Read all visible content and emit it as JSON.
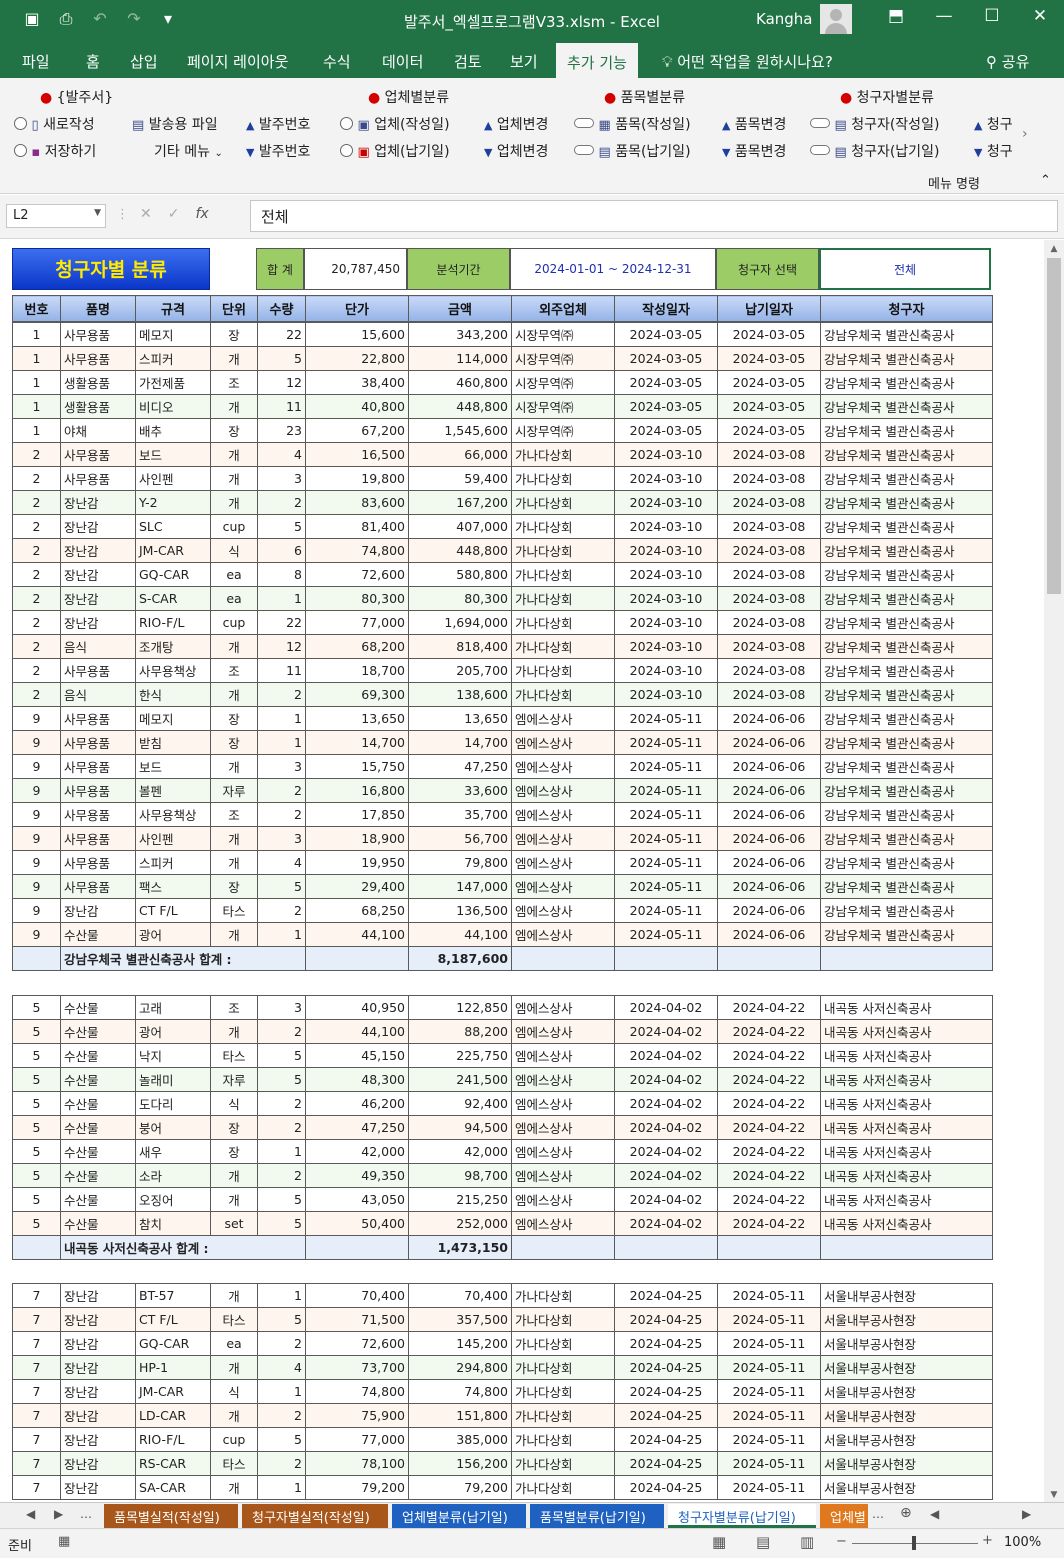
{
  "window": {
    "title": "발주서_엑셀프로그램V33.xlsm  -  Excel",
    "user": "Kangha"
  },
  "ribbon_tabs": [
    {
      "label": "파일",
      "active": false
    },
    {
      "label": "홈",
      "active": false
    },
    {
      "label": "삽입",
      "active": false
    },
    {
      "label": "페이지 레이아웃",
      "active": false
    },
    {
      "label": "수식",
      "active": false
    },
    {
      "label": "데이터",
      "active": false
    },
    {
      "label": "검토",
      "active": false
    },
    {
      "label": "보기",
      "active": false
    },
    {
      "label": "추가 기능",
      "active": true
    }
  ],
  "tell_me": "어떤 작업을 원하시나요?",
  "share": "공유",
  "ribbon": {
    "groups": [
      "{발주서}",
      "업체별분류",
      "품목별분류",
      "청구자별분류"
    ],
    "row1": [
      "새로작성",
      "발송용 파일",
      "발주번호",
      "업체(작성일)",
      "업체변경",
      "품목(작성일)",
      "품목변경",
      "청구자(작성일)",
      "청구"
    ],
    "row2": [
      "저장하기",
      "기타 메뉴",
      "발주번호",
      "업체(납기일)",
      "업체변경",
      "품목(납기일)",
      "품목변경",
      "청구자(납기일)",
      "청구"
    ],
    "footer": "메뉴 명령"
  },
  "formula_bar": {
    "name_box": "L2",
    "fx": "fx",
    "content": "전체"
  },
  "sheet": {
    "title": "청구자별 분류",
    "total_label": "합 계",
    "total_value": "20,787,450",
    "period_label": "분석기간",
    "period_value": "2024-01-01  ~  2024-12-31",
    "requester_label": "청구자 선택",
    "requester_value": "전체",
    "columns": [
      "번호",
      "품명",
      "규격",
      "단위",
      "수량",
      "단가",
      "금액",
      "외주업체",
      "작성일자",
      "납기일자",
      "청구자"
    ]
  },
  "groups": [
    {
      "rows": [
        [
          "1",
          "사무용품",
          "메모지",
          "장",
          "22",
          "15,600",
          "343,200",
          "시장무역㈜",
          "2024-03-05",
          "2024-03-05",
          "강남우체국 별관신축공사"
        ],
        [
          "1",
          "사무용품",
          "스피커",
          "개",
          "5",
          "22,800",
          "114,000",
          "시장무역㈜",
          "2024-03-05",
          "2024-03-05",
          "강남우체국 별관신축공사"
        ],
        [
          "1",
          "생활용품",
          "가전제품",
          "조",
          "12",
          "38,400",
          "460,800",
          "시장무역㈜",
          "2024-03-05",
          "2024-03-05",
          "강남우체국 별관신축공사"
        ],
        [
          "1",
          "생활용품",
          "비디오",
          "개",
          "11",
          "40,800",
          "448,800",
          "시장무역㈜",
          "2024-03-05",
          "2024-03-05",
          "강남우체국 별관신축공사"
        ],
        [
          "1",
          "야채",
          "배추",
          "장",
          "23",
          "67,200",
          "1,545,600",
          "시장무역㈜",
          "2024-03-05",
          "2024-03-05",
          "강남우체국 별관신축공사"
        ],
        [
          "2",
          "사무용품",
          "보드",
          "개",
          "4",
          "16,500",
          "66,000",
          "가나다상회",
          "2024-03-10",
          "2024-03-08",
          "강남우체국 별관신축공사"
        ],
        [
          "2",
          "사무용품",
          "사인펜",
          "개",
          "3",
          "19,800",
          "59,400",
          "가나다상회",
          "2024-03-10",
          "2024-03-08",
          "강남우체국 별관신축공사"
        ],
        [
          "2",
          "장난감",
          "Y-2",
          "개",
          "2",
          "83,600",
          "167,200",
          "가나다상회",
          "2024-03-10",
          "2024-03-08",
          "강남우체국 별관신축공사"
        ],
        [
          "2",
          "장난감",
          "SLC",
          "cup",
          "5",
          "81,400",
          "407,000",
          "가나다상회",
          "2024-03-10",
          "2024-03-08",
          "강남우체국 별관신축공사"
        ],
        [
          "2",
          "장난감",
          "JM-CAR",
          "식",
          "6",
          "74,800",
          "448,800",
          "가나다상회",
          "2024-03-10",
          "2024-03-08",
          "강남우체국 별관신축공사"
        ],
        [
          "2",
          "장난감",
          "GQ-CAR",
          "ea",
          "8",
          "72,600",
          "580,800",
          "가나다상회",
          "2024-03-10",
          "2024-03-08",
          "강남우체국 별관신축공사"
        ],
        [
          "2",
          "장난감",
          "S-CAR",
          "ea",
          "1",
          "80,300",
          "80,300",
          "가나다상회",
          "2024-03-10",
          "2024-03-08",
          "강남우체국 별관신축공사"
        ],
        [
          "2",
          "장난감",
          "RIO-F/L",
          "cup",
          "22",
          "77,000",
          "1,694,000",
          "가나다상회",
          "2024-03-10",
          "2024-03-08",
          "강남우체국 별관신축공사"
        ],
        [
          "2",
          "음식",
          "조개탕",
          "개",
          "12",
          "68,200",
          "818,400",
          "가나다상회",
          "2024-03-10",
          "2024-03-08",
          "강남우체국 별관신축공사"
        ],
        [
          "2",
          "사무용품",
          "사무용책상",
          "조",
          "11",
          "18,700",
          "205,700",
          "가나다상회",
          "2024-03-10",
          "2024-03-08",
          "강남우체국 별관신축공사"
        ],
        [
          "2",
          "음식",
          "한식",
          "개",
          "2",
          "69,300",
          "138,600",
          "가나다상회",
          "2024-03-10",
          "2024-03-08",
          "강남우체국 별관신축공사"
        ],
        [
          "9",
          "사무용품",
          "메모지",
          "장",
          "1",
          "13,650",
          "13,650",
          "엠에스상사",
          "2024-05-11",
          "2024-06-06",
          "강남우체국 별관신축공사"
        ],
        [
          "9",
          "사무용품",
          "받침",
          "장",
          "1",
          "14,700",
          "14,700",
          "엠에스상사",
          "2024-05-11",
          "2024-06-06",
          "강남우체국 별관신축공사"
        ],
        [
          "9",
          "사무용품",
          "보드",
          "개",
          "3",
          "15,750",
          "47,250",
          "엠에스상사",
          "2024-05-11",
          "2024-06-06",
          "강남우체국 별관신축공사"
        ],
        [
          "9",
          "사무용품",
          "볼펜",
          "자루",
          "2",
          "16,800",
          "33,600",
          "엠에스상사",
          "2024-05-11",
          "2024-06-06",
          "강남우체국 별관신축공사"
        ],
        [
          "9",
          "사무용품",
          "사무용책상",
          "조",
          "2",
          "17,850",
          "35,700",
          "엠에스상사",
          "2024-05-11",
          "2024-06-06",
          "강남우체국 별관신축공사"
        ],
        [
          "9",
          "사무용품",
          "사인펜",
          "개",
          "3",
          "18,900",
          "56,700",
          "엠에스상사",
          "2024-05-11",
          "2024-06-06",
          "강남우체국 별관신축공사"
        ],
        [
          "9",
          "사무용품",
          "스피커",
          "개",
          "4",
          "19,950",
          "79,800",
          "엠에스상사",
          "2024-05-11",
          "2024-06-06",
          "강남우체국 별관신축공사"
        ],
        [
          "9",
          "사무용품",
          "팩스",
          "장",
          "5",
          "29,400",
          "147,000",
          "엠에스상사",
          "2024-05-11",
          "2024-06-06",
          "강남우체국 별관신축공사"
        ],
        [
          "9",
          "장난감",
          "CT F/L",
          "타스",
          "2",
          "68,250",
          "136,500",
          "엠에스상사",
          "2024-05-11",
          "2024-06-06",
          "강남우체국 별관신축공사"
        ],
        [
          "9",
          "수산물",
          "광어",
          "개",
          "1",
          "44,100",
          "44,100",
          "엠에스상사",
          "2024-05-11",
          "2024-06-06",
          "강남우체국 별관신축공사"
        ]
      ],
      "subtotal_label": "강남우체국 별관신축공사 합계  :",
      "subtotal_value": "8,187,600"
    },
    {
      "rows": [
        [
          "5",
          "수산물",
          "고래",
          "조",
          "3",
          "40,950",
          "122,850",
          "엠에스상사",
          "2024-04-02",
          "2024-04-22",
          "내곡동 사저신축공사"
        ],
        [
          "5",
          "수산물",
          "광어",
          "개",
          "2",
          "44,100",
          "88,200",
          "엠에스상사",
          "2024-04-02",
          "2024-04-22",
          "내곡동 사저신축공사"
        ],
        [
          "5",
          "수산물",
          "낙지",
          "타스",
          "5",
          "45,150",
          "225,750",
          "엠에스상사",
          "2024-04-02",
          "2024-04-22",
          "내곡동 사저신축공사"
        ],
        [
          "5",
          "수산물",
          "놀래미",
          "자루",
          "5",
          "48,300",
          "241,500",
          "엠에스상사",
          "2024-04-02",
          "2024-04-22",
          "내곡동 사저신축공사"
        ],
        [
          "5",
          "수산물",
          "도다리",
          "식",
          "2",
          "46,200",
          "92,400",
          "엠에스상사",
          "2024-04-02",
          "2024-04-22",
          "내곡동 사저신축공사"
        ],
        [
          "5",
          "수산물",
          "붕어",
          "장",
          "2",
          "47,250",
          "94,500",
          "엠에스상사",
          "2024-04-02",
          "2024-04-22",
          "내곡동 사저신축공사"
        ],
        [
          "5",
          "수산물",
          "새우",
          "장",
          "1",
          "42,000",
          "42,000",
          "엠에스상사",
          "2024-04-02",
          "2024-04-22",
          "내곡동 사저신축공사"
        ],
        [
          "5",
          "수산물",
          "소라",
          "개",
          "2",
          "49,350",
          "98,700",
          "엠에스상사",
          "2024-04-02",
          "2024-04-22",
          "내곡동 사저신축공사"
        ],
        [
          "5",
          "수산물",
          "오징어",
          "개",
          "5",
          "43,050",
          "215,250",
          "엠에스상사",
          "2024-04-02",
          "2024-04-22",
          "내곡동 사저신축공사"
        ],
        [
          "5",
          "수산물",
          "참치",
          "set",
          "5",
          "50,400",
          "252,000",
          "엠에스상사",
          "2024-04-02",
          "2024-04-22",
          "내곡동 사저신축공사"
        ]
      ],
      "subtotal_label": "내곡동 사저신축공사 합계  :",
      "subtotal_value": "1,473,150"
    },
    {
      "rows": [
        [
          "7",
          "장난감",
          "BT-57",
          "개",
          "1",
          "70,400",
          "70,400",
          "가나다상회",
          "2024-04-25",
          "2024-05-11",
          "서울내부공사현장"
        ],
        [
          "7",
          "장난감",
          "CT F/L",
          "타스",
          "5",
          "71,500",
          "357,500",
          "가나다상회",
          "2024-04-25",
          "2024-05-11",
          "서울내부공사현장"
        ],
        [
          "7",
          "장난감",
          "GQ-CAR",
          "ea",
          "2",
          "72,600",
          "145,200",
          "가나다상회",
          "2024-04-25",
          "2024-05-11",
          "서울내부공사현장"
        ],
        [
          "7",
          "장난감",
          "HP-1",
          "개",
          "4",
          "73,700",
          "294,800",
          "가나다상회",
          "2024-04-25",
          "2024-05-11",
          "서울내부공사현장"
        ],
        [
          "7",
          "장난감",
          "JM-CAR",
          "식",
          "1",
          "74,800",
          "74,800",
          "가나다상회",
          "2024-04-25",
          "2024-05-11",
          "서울내부공사현장"
        ],
        [
          "7",
          "장난감",
          "LD-CAR",
          "개",
          "2",
          "75,900",
          "151,800",
          "가나다상회",
          "2024-04-25",
          "2024-05-11",
          "서울내부공사현장"
        ],
        [
          "7",
          "장난감",
          "RIO-F/L",
          "cup",
          "5",
          "77,000",
          "385,000",
          "가나다상회",
          "2024-04-25",
          "2024-05-11",
          "서울내부공사현장"
        ],
        [
          "7",
          "장난감",
          "RS-CAR",
          "타스",
          "2",
          "78,100",
          "156,200",
          "가나다상회",
          "2024-04-25",
          "2024-05-11",
          "서울내부공사현장"
        ],
        [
          "7",
          "장난감",
          "SA-CAR",
          "개",
          "1",
          "79,200",
          "79,200",
          "가나다상회",
          "2024-04-25",
          "2024-05-11",
          "서울내부공사현장"
        ]
      ]
    }
  ],
  "sheet_tabs": [
    {
      "label": "품목별실적(작성일)",
      "color": "brown"
    },
    {
      "label": "청구자별실적(작성일)",
      "color": "brown"
    },
    {
      "label": "업체별분류(납기일)",
      "color": "blue"
    },
    {
      "label": "품목별분류(납기일)",
      "color": "blue"
    },
    {
      "label": "청구자별분류(납기일)",
      "color": "active"
    },
    {
      "label": "업체별",
      "color": "orange"
    }
  ],
  "status": {
    "ready": "준비",
    "zoom": "100%"
  }
}
